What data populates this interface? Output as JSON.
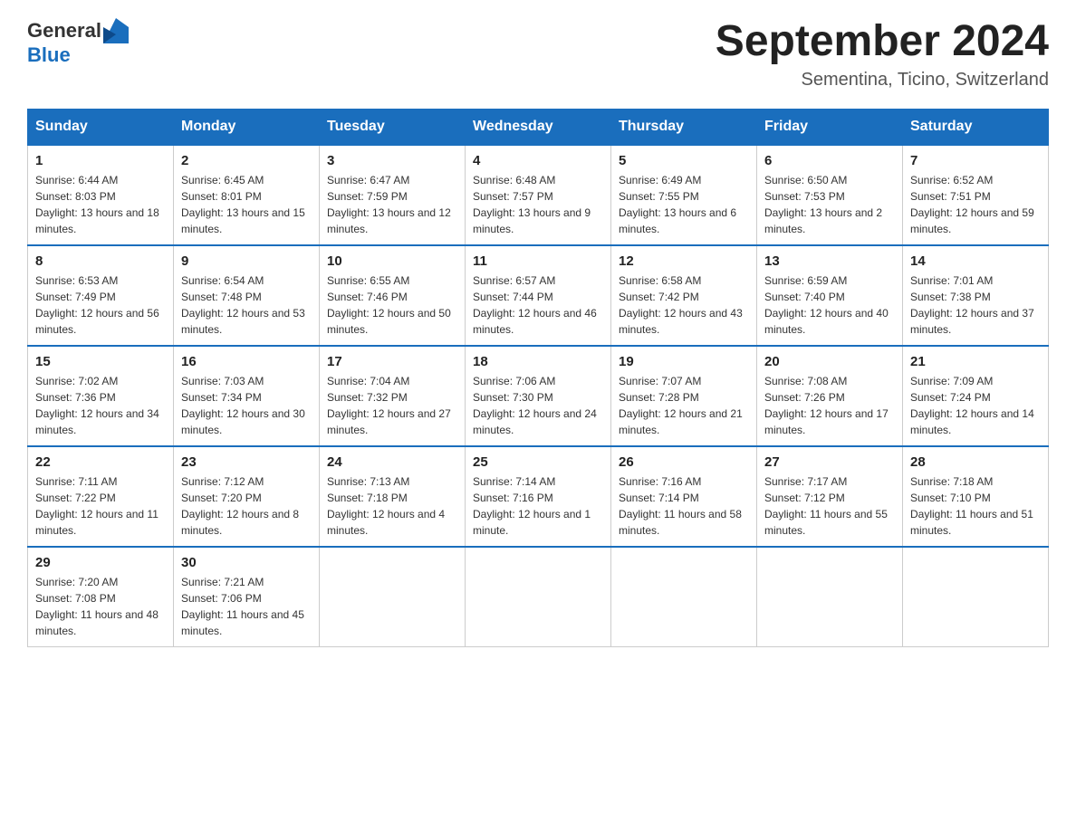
{
  "header": {
    "logo_text_general": "General",
    "logo_text_blue": "Blue",
    "month_title": "September 2024",
    "subtitle": "Sementina, Ticino, Switzerland"
  },
  "weekdays": [
    "Sunday",
    "Monday",
    "Tuesday",
    "Wednesday",
    "Thursday",
    "Friday",
    "Saturday"
  ],
  "weeks": [
    [
      {
        "day": "1",
        "sunrise": "6:44 AM",
        "sunset": "8:03 PM",
        "daylight": "13 hours and 18 minutes."
      },
      {
        "day": "2",
        "sunrise": "6:45 AM",
        "sunset": "8:01 PM",
        "daylight": "13 hours and 15 minutes."
      },
      {
        "day": "3",
        "sunrise": "6:47 AM",
        "sunset": "7:59 PM",
        "daylight": "13 hours and 12 minutes."
      },
      {
        "day": "4",
        "sunrise": "6:48 AM",
        "sunset": "7:57 PM",
        "daylight": "13 hours and 9 minutes."
      },
      {
        "day": "5",
        "sunrise": "6:49 AM",
        "sunset": "7:55 PM",
        "daylight": "13 hours and 6 minutes."
      },
      {
        "day": "6",
        "sunrise": "6:50 AM",
        "sunset": "7:53 PM",
        "daylight": "13 hours and 2 minutes."
      },
      {
        "day": "7",
        "sunrise": "6:52 AM",
        "sunset": "7:51 PM",
        "daylight": "12 hours and 59 minutes."
      }
    ],
    [
      {
        "day": "8",
        "sunrise": "6:53 AM",
        "sunset": "7:49 PM",
        "daylight": "12 hours and 56 minutes."
      },
      {
        "day": "9",
        "sunrise": "6:54 AM",
        "sunset": "7:48 PM",
        "daylight": "12 hours and 53 minutes."
      },
      {
        "day": "10",
        "sunrise": "6:55 AM",
        "sunset": "7:46 PM",
        "daylight": "12 hours and 50 minutes."
      },
      {
        "day": "11",
        "sunrise": "6:57 AM",
        "sunset": "7:44 PM",
        "daylight": "12 hours and 46 minutes."
      },
      {
        "day": "12",
        "sunrise": "6:58 AM",
        "sunset": "7:42 PM",
        "daylight": "12 hours and 43 minutes."
      },
      {
        "day": "13",
        "sunrise": "6:59 AM",
        "sunset": "7:40 PM",
        "daylight": "12 hours and 40 minutes."
      },
      {
        "day": "14",
        "sunrise": "7:01 AM",
        "sunset": "7:38 PM",
        "daylight": "12 hours and 37 minutes."
      }
    ],
    [
      {
        "day": "15",
        "sunrise": "7:02 AM",
        "sunset": "7:36 PM",
        "daylight": "12 hours and 34 minutes."
      },
      {
        "day": "16",
        "sunrise": "7:03 AM",
        "sunset": "7:34 PM",
        "daylight": "12 hours and 30 minutes."
      },
      {
        "day": "17",
        "sunrise": "7:04 AM",
        "sunset": "7:32 PM",
        "daylight": "12 hours and 27 minutes."
      },
      {
        "day": "18",
        "sunrise": "7:06 AM",
        "sunset": "7:30 PM",
        "daylight": "12 hours and 24 minutes."
      },
      {
        "day": "19",
        "sunrise": "7:07 AM",
        "sunset": "7:28 PM",
        "daylight": "12 hours and 21 minutes."
      },
      {
        "day": "20",
        "sunrise": "7:08 AM",
        "sunset": "7:26 PM",
        "daylight": "12 hours and 17 minutes."
      },
      {
        "day": "21",
        "sunrise": "7:09 AM",
        "sunset": "7:24 PM",
        "daylight": "12 hours and 14 minutes."
      }
    ],
    [
      {
        "day": "22",
        "sunrise": "7:11 AM",
        "sunset": "7:22 PM",
        "daylight": "12 hours and 11 minutes."
      },
      {
        "day": "23",
        "sunrise": "7:12 AM",
        "sunset": "7:20 PM",
        "daylight": "12 hours and 8 minutes."
      },
      {
        "day": "24",
        "sunrise": "7:13 AM",
        "sunset": "7:18 PM",
        "daylight": "12 hours and 4 minutes."
      },
      {
        "day": "25",
        "sunrise": "7:14 AM",
        "sunset": "7:16 PM",
        "daylight": "12 hours and 1 minute."
      },
      {
        "day": "26",
        "sunrise": "7:16 AM",
        "sunset": "7:14 PM",
        "daylight": "11 hours and 58 minutes."
      },
      {
        "day": "27",
        "sunrise": "7:17 AM",
        "sunset": "7:12 PM",
        "daylight": "11 hours and 55 minutes."
      },
      {
        "day": "28",
        "sunrise": "7:18 AM",
        "sunset": "7:10 PM",
        "daylight": "11 hours and 51 minutes."
      }
    ],
    [
      {
        "day": "29",
        "sunrise": "7:20 AM",
        "sunset": "7:08 PM",
        "daylight": "11 hours and 48 minutes."
      },
      {
        "day": "30",
        "sunrise": "7:21 AM",
        "sunset": "7:06 PM",
        "daylight": "11 hours and 45 minutes."
      },
      null,
      null,
      null,
      null,
      null
    ]
  ]
}
